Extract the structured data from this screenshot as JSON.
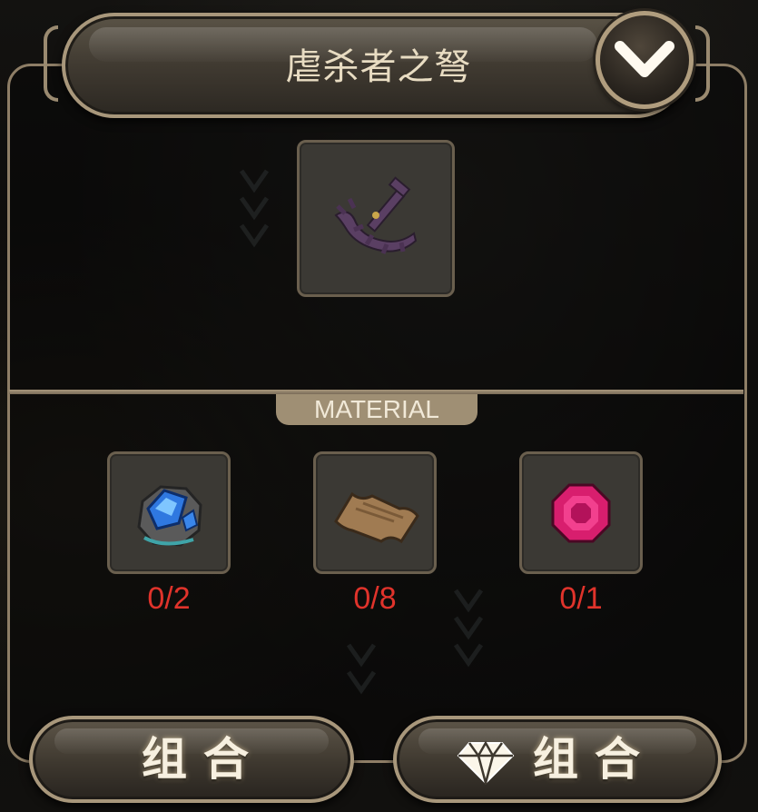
{
  "header": {
    "title": "虐杀者之弩",
    "dropdown_icon": "chevron-down-icon"
  },
  "result_item": {
    "icon": "crossbow-icon"
  },
  "materials": {
    "section_label": "MATERIAL",
    "items": [
      {
        "icon": "blue-crystal-ore-icon",
        "count": "0/2"
      },
      {
        "icon": "leather-hide-icon",
        "count": "0/8"
      },
      {
        "icon": "ruby-gem-icon",
        "count": "0/1"
      }
    ]
  },
  "actions": {
    "combine_label": "组合",
    "gem_combine_label": "组合",
    "gem_icon": "diamond-icon"
  },
  "colors": {
    "frame": "#a8977b",
    "count_insufficient": "#e0332b",
    "label_text": "#e8dcc2"
  }
}
